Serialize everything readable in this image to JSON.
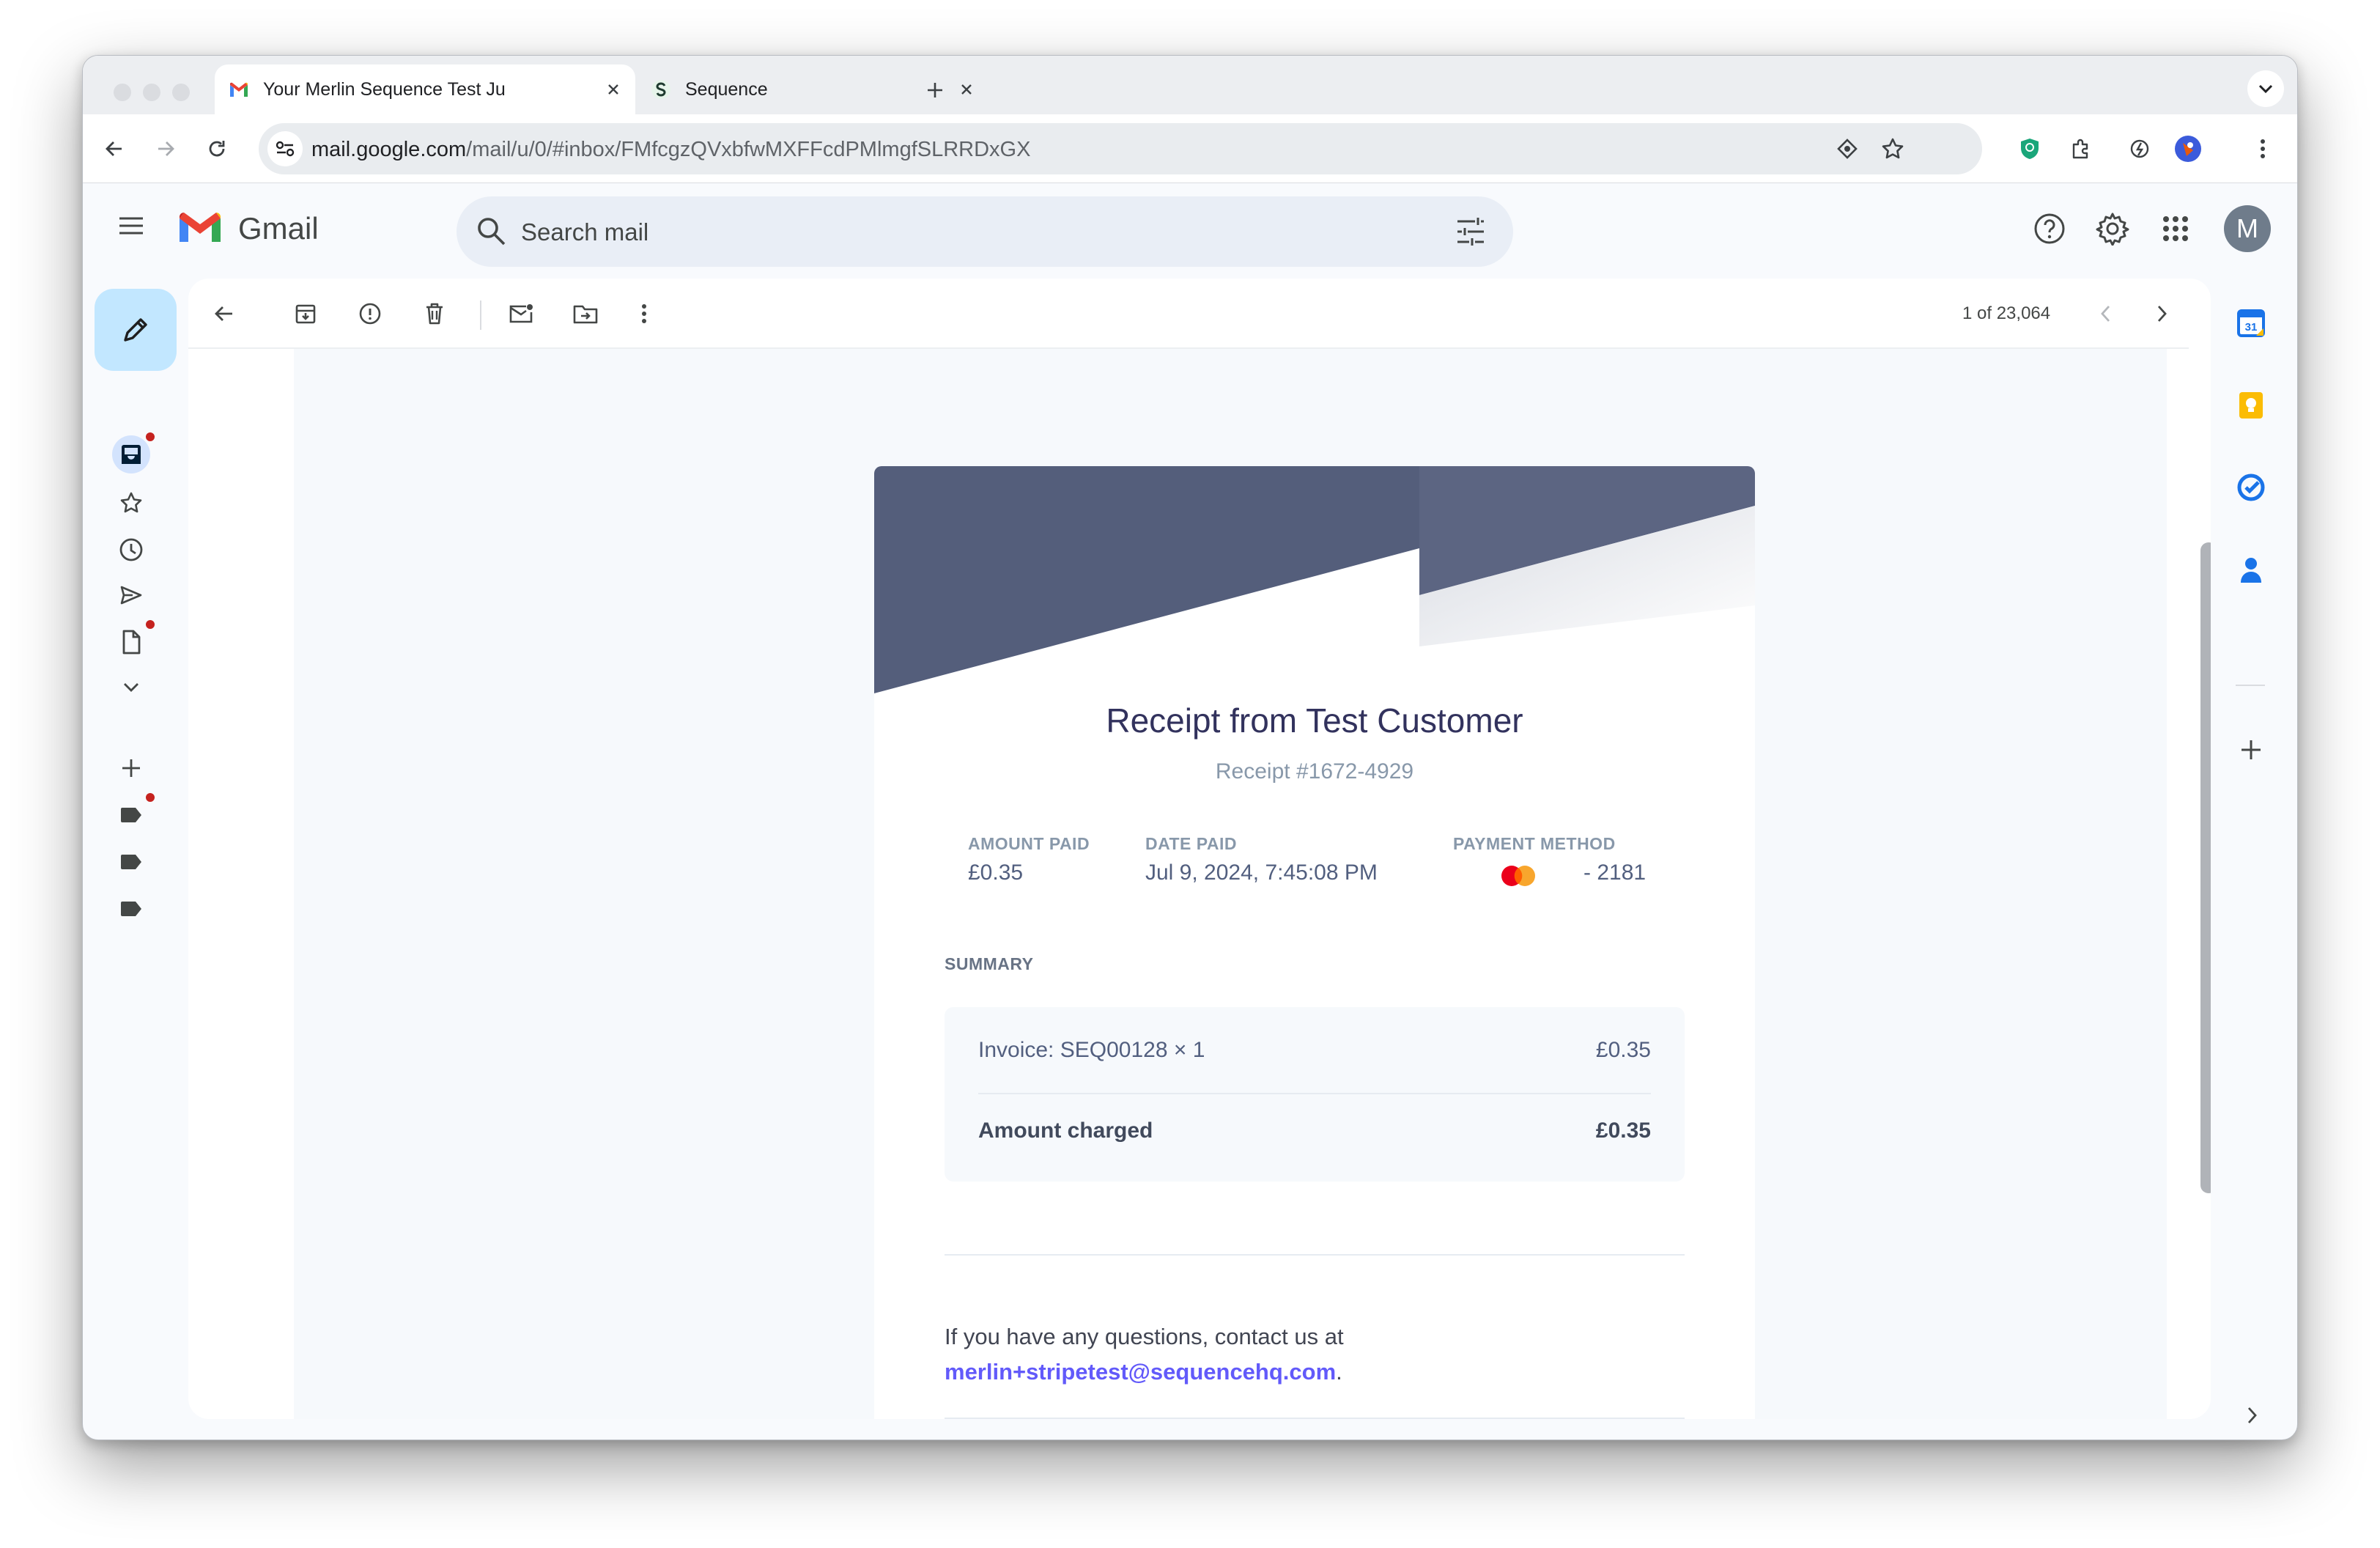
{
  "browser": {
    "tabs": [
      {
        "title": "Your Merlin Sequence Test Ju",
        "favicon": "gmail-icon",
        "active": true
      },
      {
        "title": "Sequence",
        "favicon": "sequence-icon",
        "active": false
      }
    ],
    "url_host": "mail.google.com",
    "url_path": "/mail/u/0/#inbox/FMfcgzQVxbfwMXFFcdPMlmgfSLRRDxGX"
  },
  "gmail": {
    "app_name": "Gmail",
    "search_placeholder": "Search mail",
    "account_initial": "M",
    "pagination": "1 of 23,064"
  },
  "receipt": {
    "title": "Receipt from Test Customer",
    "receipt_number": "Receipt #1672-4929",
    "amount_paid_label": "AMOUNT PAID",
    "amount_paid": "£0.35",
    "date_paid_label": "DATE PAID",
    "date_paid": "Jul 9, 2024, 7:45:08 PM",
    "payment_method_label": "PAYMENT METHOD",
    "card_last4": "- 2181",
    "summary_label": "SUMMARY",
    "line_item": {
      "label": "Invoice: SEQ00128 × 1",
      "amount": "£0.35"
    },
    "total": {
      "label": "Amount charged",
      "amount": "£0.35"
    },
    "contact_text": "If you have any questions, contact us at",
    "contact_email": "merlin+stripetest@sequencehq.com",
    "contact_suffix": "."
  },
  "colors": {
    "header_dark": "#545e7b",
    "header_light": "#5c6582",
    "link": "#625afa",
    "compose_bg": "#c2e7ff",
    "avatar_bg": "#6f7c8b"
  }
}
